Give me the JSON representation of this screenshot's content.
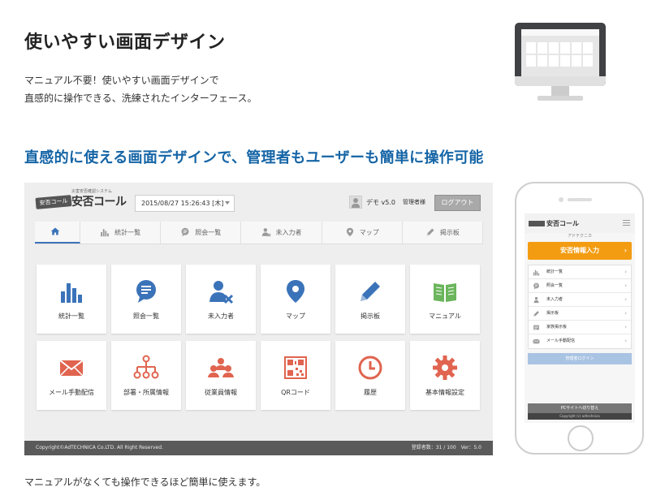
{
  "heading": "使いやすい画面デザイン",
  "intro_line1": "マニュアル不要！使いやすい画面デザインで",
  "intro_line2": "直感的に操作できる、洗練されたインターフェース。",
  "subheading": "直感的に使える画面デザインで、管理者もユーザーも簡単に操作可能",
  "footer_text": "マニュアルがなくても操作できるほど簡単に使えます。",
  "app": {
    "logo_badge": "安否コール",
    "logo_sub": "災害安否確認システム",
    "logo_text": "安否コール",
    "datetime": "2015/08/27 15:26:43 [木]",
    "user_name": "デモ v5.0",
    "user_role": "管理者様",
    "logout": "ログアウト",
    "nav": [
      {
        "label": "",
        "icon": "home-icon"
      },
      {
        "label": "統計一覧",
        "icon": "bar-chart-icon"
      },
      {
        "label": "照会一覧",
        "icon": "chat-icon"
      },
      {
        "label": "未入力者",
        "icon": "user-x-icon"
      },
      {
        "label": "マップ",
        "icon": "map-pin-icon"
      },
      {
        "label": "掲示板",
        "icon": "pencil-icon"
      }
    ],
    "tiles": [
      {
        "label": "統計一覧",
        "icon": "bar-chart-icon",
        "color": "#3b73b9"
      },
      {
        "label": "照会一覧",
        "icon": "chat-icon",
        "color": "#3b73b9"
      },
      {
        "label": "未入力者",
        "icon": "user-x-icon",
        "color": "#3b73b9"
      },
      {
        "label": "マップ",
        "icon": "map-pin-icon",
        "color": "#3b73b9"
      },
      {
        "label": "掲示板",
        "icon": "pencil-icon",
        "color": "#3b73b9"
      },
      {
        "label": "マニュアル",
        "icon": "book-icon",
        "color": "#6bb55c"
      },
      {
        "label": "メール手動配信",
        "icon": "mail-icon",
        "color": "#e0644f"
      },
      {
        "label": "部署・所属情報",
        "icon": "org-chart-icon",
        "color": "#e0644f"
      },
      {
        "label": "従業員情報",
        "icon": "people-icon",
        "color": "#e0644f"
      },
      {
        "label": "QRコード",
        "icon": "qr-code-icon",
        "color": "#e0644f"
      },
      {
        "label": "履歴",
        "icon": "clock-icon",
        "color": "#e0644f"
      },
      {
        "label": "基本情報設定",
        "icon": "gear-icon",
        "color": "#e0644f"
      }
    ],
    "copyright": "Copyright©AdTECHNICA Co.LTD. All Right Reserved.",
    "reg_count": "登録者数：31 / 100　Ver：5.0"
  },
  "mobile": {
    "logo": "安否コール",
    "company": "アドテクニカ",
    "primary_button": "安否情報入力",
    "menu": [
      {
        "label": "統計一覧",
        "icon": "bar-chart-icon"
      },
      {
        "label": "照会一覧",
        "icon": "chat-icon"
      },
      {
        "label": "未入力者",
        "icon": "user-icon"
      },
      {
        "label": "掲示板",
        "icon": "pencil-icon"
      },
      {
        "label": "家族掲示板",
        "icon": "family-icon"
      },
      {
        "label": "メール手動配信",
        "icon": "mail-icon"
      }
    ],
    "login_button": "管理者ログイン",
    "pc_site": "PCサイトへ切り替え",
    "copyright": "Copyright (c) adtechnica"
  }
}
